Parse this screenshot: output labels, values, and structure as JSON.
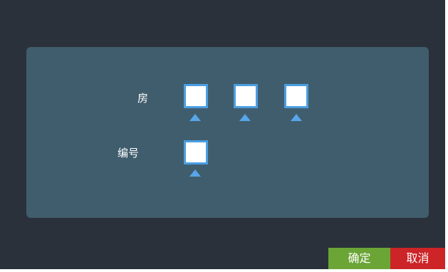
{
  "form": {
    "room_label": "房",
    "number_label": "编号"
  },
  "buttons": {
    "confirm_label": "确定",
    "cancel_label": "取消"
  },
  "colors": {
    "background": "#2a313a",
    "panel": "#405d6d",
    "box_border": "#4a9fe3",
    "arrow": "#57a6e8",
    "confirm": "#6aa536",
    "cancel": "#cc2427"
  }
}
